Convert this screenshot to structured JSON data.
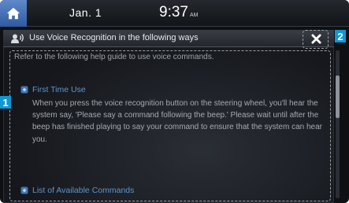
{
  "status_bar": {
    "date": "Jan.  1",
    "time": "9:37",
    "ampm": "AM"
  },
  "popup": {
    "title": "Use Voice Recognition in the following ways",
    "close_label": "✕"
  },
  "callouts": {
    "content_number": "1",
    "close_number": "2"
  },
  "content": {
    "intro": "Refer to the following help guide to use voice commands.",
    "sections": [
      {
        "title": "First Time Use",
        "text": "When you press the voice recognition button on the steering wheel, you'll hear the system say, 'Please say a command following the beep.' Please wait until after the beep has finished playing to say your command to ensure that the system can hear you."
      },
      {
        "title": "List of Available Commands"
      }
    ]
  },
  "colors": {
    "accent_blue": "#5c96cf",
    "badge_blue": "#0f98d4",
    "home_blue": "#3f6db5"
  },
  "icons": {
    "home": "home-icon",
    "voice": "voice-recognition-icon",
    "close": "close-icon",
    "bullet": "bullet-icon"
  }
}
